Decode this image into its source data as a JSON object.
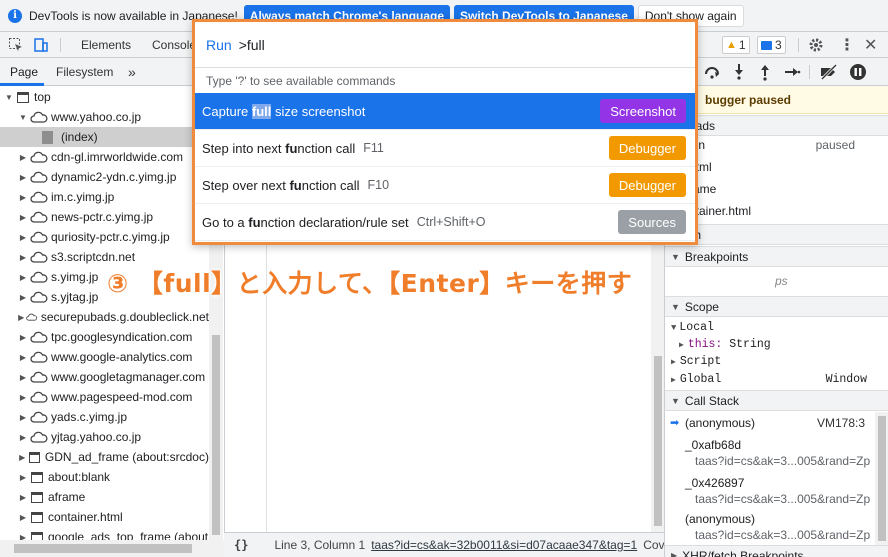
{
  "infobar": {
    "message": "DevTools is now available in Japanese!",
    "btn_match": "Always match Chrome's language",
    "btn_switch": "Switch DevTools to Japanese",
    "btn_dont": "Don't show again"
  },
  "toolbar": {
    "tab_elements": "Elements",
    "tab_console": "Console",
    "warn_count": "1",
    "msg_count": "3"
  },
  "sidebar": {
    "tab_page": "Page",
    "tab_filesystem": "Filesystem",
    "more": "»",
    "items": [
      {
        "label": "top",
        "type": "frame",
        "tri": "▼",
        "indent": 0
      },
      {
        "label": "www.yahoo.co.jp",
        "type": "cloud",
        "tri": "▼",
        "indent": 1
      },
      {
        "label": "(index)",
        "type": "file",
        "tri": "",
        "indent": 2
      },
      {
        "label": "cdn-gl.imrworldwide.com",
        "type": "cloud",
        "tri": "▶",
        "indent": 1
      },
      {
        "label": "dynamic2-ydn.c.yimg.jp",
        "type": "cloud",
        "tri": "▶",
        "indent": 1
      },
      {
        "label": "im.c.yimg.jp",
        "type": "cloud",
        "tri": "▶",
        "indent": 1
      },
      {
        "label": "news-pctr.c.yimg.jp",
        "type": "cloud",
        "tri": "▶",
        "indent": 1
      },
      {
        "label": "quriosity-pctr.c.yimg.jp",
        "type": "cloud",
        "tri": "▶",
        "indent": 1
      },
      {
        "label": "s3.scriptcdn.net",
        "type": "cloud",
        "tri": "▶",
        "indent": 1
      },
      {
        "label": "s.yimg.jp",
        "type": "cloud",
        "tri": "▶",
        "indent": 1
      },
      {
        "label": "s.yjtag.jp",
        "type": "cloud",
        "tri": "▶",
        "indent": 1
      },
      {
        "label": "securepubads.g.doubleclick.net",
        "type": "cloud",
        "tri": "▶",
        "indent": 1
      },
      {
        "label": "tpc.googlesyndication.com",
        "type": "cloud",
        "tri": "▶",
        "indent": 1
      },
      {
        "label": "www.google-analytics.com",
        "type": "cloud",
        "tri": "▶",
        "indent": 1
      },
      {
        "label": "www.googletagmanager.com",
        "type": "cloud",
        "tri": "▶",
        "indent": 1
      },
      {
        "label": "www.pagespeed-mod.com",
        "type": "cloud",
        "tri": "▶",
        "indent": 1
      },
      {
        "label": "yads.c.yimg.jp",
        "type": "cloud",
        "tri": "▶",
        "indent": 1
      },
      {
        "label": "yjtag.yahoo.co.jp",
        "type": "cloud",
        "tri": "▶",
        "indent": 1
      },
      {
        "label": "GDN_ad_frame (about:srcdoc)",
        "type": "frame",
        "tri": "▶",
        "indent": 1
      },
      {
        "label": "about:blank",
        "type": "frame",
        "tri": "▶",
        "indent": 1
      },
      {
        "label": "aframe",
        "type": "frame",
        "tri": "▶",
        "indent": 1
      },
      {
        "label": "container.html",
        "type": "frame",
        "tri": "▶",
        "indent": 1
      },
      {
        "label": "google_ads_top_frame (about",
        "type": "frame",
        "tri": "▶",
        "indent": 1
      }
    ]
  },
  "statusbar": {
    "braces": "{}",
    "position": "Line 3, Column 1",
    "link": "taas?id=cs&ak=32b0011&si=d07acaae347&tag=1",
    "coverage": "Cove"
  },
  "right": {
    "paused": "bugger paused",
    "threads_label": "eads",
    "threads": [
      {
        "name": "ain",
        "status": "paused"
      },
      {
        "name": "html",
        "status": ""
      },
      {
        "name": "rame",
        "status": ""
      },
      {
        "name": "ntainer.html",
        "status": ""
      }
    ],
    "watch": "tch",
    "breakpoints": "Breakpoints",
    "bp_hint": "ps",
    "scope": "Scope",
    "local": "Local",
    "this_key": "this:",
    "this_val": "String",
    "script": "Script",
    "global": "Global",
    "global_val": "Window",
    "call_stack": "Call Stack",
    "frames": [
      {
        "name": "(anonymous)",
        "loc": "VM178:3",
        "sub": ""
      },
      {
        "name": "_0xafb68d",
        "loc": "",
        "sub": "taas?id=cs&ak=3...005&rand=Zp"
      },
      {
        "name": "_0x426897",
        "loc": "",
        "sub": "taas?id=cs&ak=3...005&rand=Zp"
      },
      {
        "name": "(anonymous)",
        "loc": "",
        "sub": "taas?id=cs&ak=3...005&rand=Zp"
      }
    ],
    "xhr": "XHR/fetch Breakpoints"
  },
  "palette": {
    "prefix": "Run",
    "query": ">full",
    "hint": "Type '?' to see available commands",
    "rows": [
      {
        "pre": "Capture ",
        "hl": "full",
        "post": " size screenshot",
        "shortcut": "",
        "badge": "Screenshot",
        "badge_color": "#9334e6",
        "selected": true
      },
      {
        "pre": "Step into next ",
        "hl": "fu",
        "post": "nction call",
        "shortcut": "F11",
        "badge": "Debugger",
        "badge_color": "#f29900",
        "selected": false
      },
      {
        "pre": "Step over next ",
        "hl": "fu",
        "post": "nction call",
        "shortcut": "F10",
        "badge": "Debugger",
        "badge_color": "#f29900",
        "selected": false
      },
      {
        "pre": "Go to a ",
        "hl": "fu",
        "post": "nction declaration/rule set",
        "shortcut": "Ctrl+Shift+O",
        "badge": "Sources",
        "badge_color": "#9aa0a6",
        "selected": false
      }
    ]
  },
  "callout": "③ 【full】と入力して、【Enter】キーを押す",
  "colors": {
    "accent": "#1a73e8",
    "callout": "#f07d2a",
    "palette_border": "#f08a3c"
  }
}
